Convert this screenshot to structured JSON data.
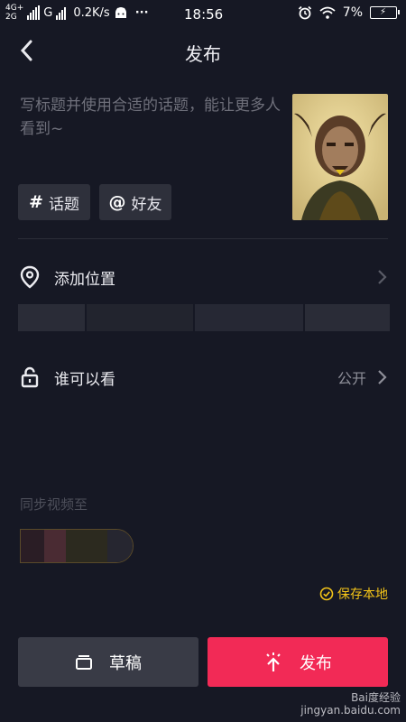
{
  "statusbar": {
    "network_top": "4G+",
    "network_bottom": "2G",
    "carrier2": "G",
    "speed": "0.2K/s",
    "dots": "···",
    "time": "18:56",
    "battery_pct": "7%",
    "icons": [
      "signal-icon",
      "android-icon",
      "alarm-icon",
      "wifi-icon",
      "battery-icon"
    ]
  },
  "header": {
    "title": "发布",
    "back_icon": "chevron-left-icon"
  },
  "compose": {
    "placeholder": "写标题并使用合适的话题，能让更多人看到~",
    "thumbnail_icon": "video-cover-thumbnail"
  },
  "chips": [
    {
      "symbol": "#",
      "label": "话题"
    },
    {
      "symbol": "@",
      "label": "好友"
    }
  ],
  "location": {
    "label": "添加位置",
    "icon": "location-pin-icon"
  },
  "visibility": {
    "label": "谁可以看",
    "value": "公开",
    "icon": "unlock-icon"
  },
  "sync": {
    "label": "同步视频至"
  },
  "save_local": {
    "label": "保存本地",
    "icon": "check-circle-icon"
  },
  "footer": {
    "draft_label": "草稿",
    "publish_label": "发布",
    "draft_icon": "draft-box-icon",
    "publish_icon": "upload-arrow-icon"
  },
  "watermark": {
    "line1": "Bai度经验",
    "line2": "jingyan.baidu.com"
  },
  "colors": {
    "background": "#161824",
    "accent": "#f22a56",
    "gold": "#f5c518",
    "chip": "#2e303b"
  }
}
